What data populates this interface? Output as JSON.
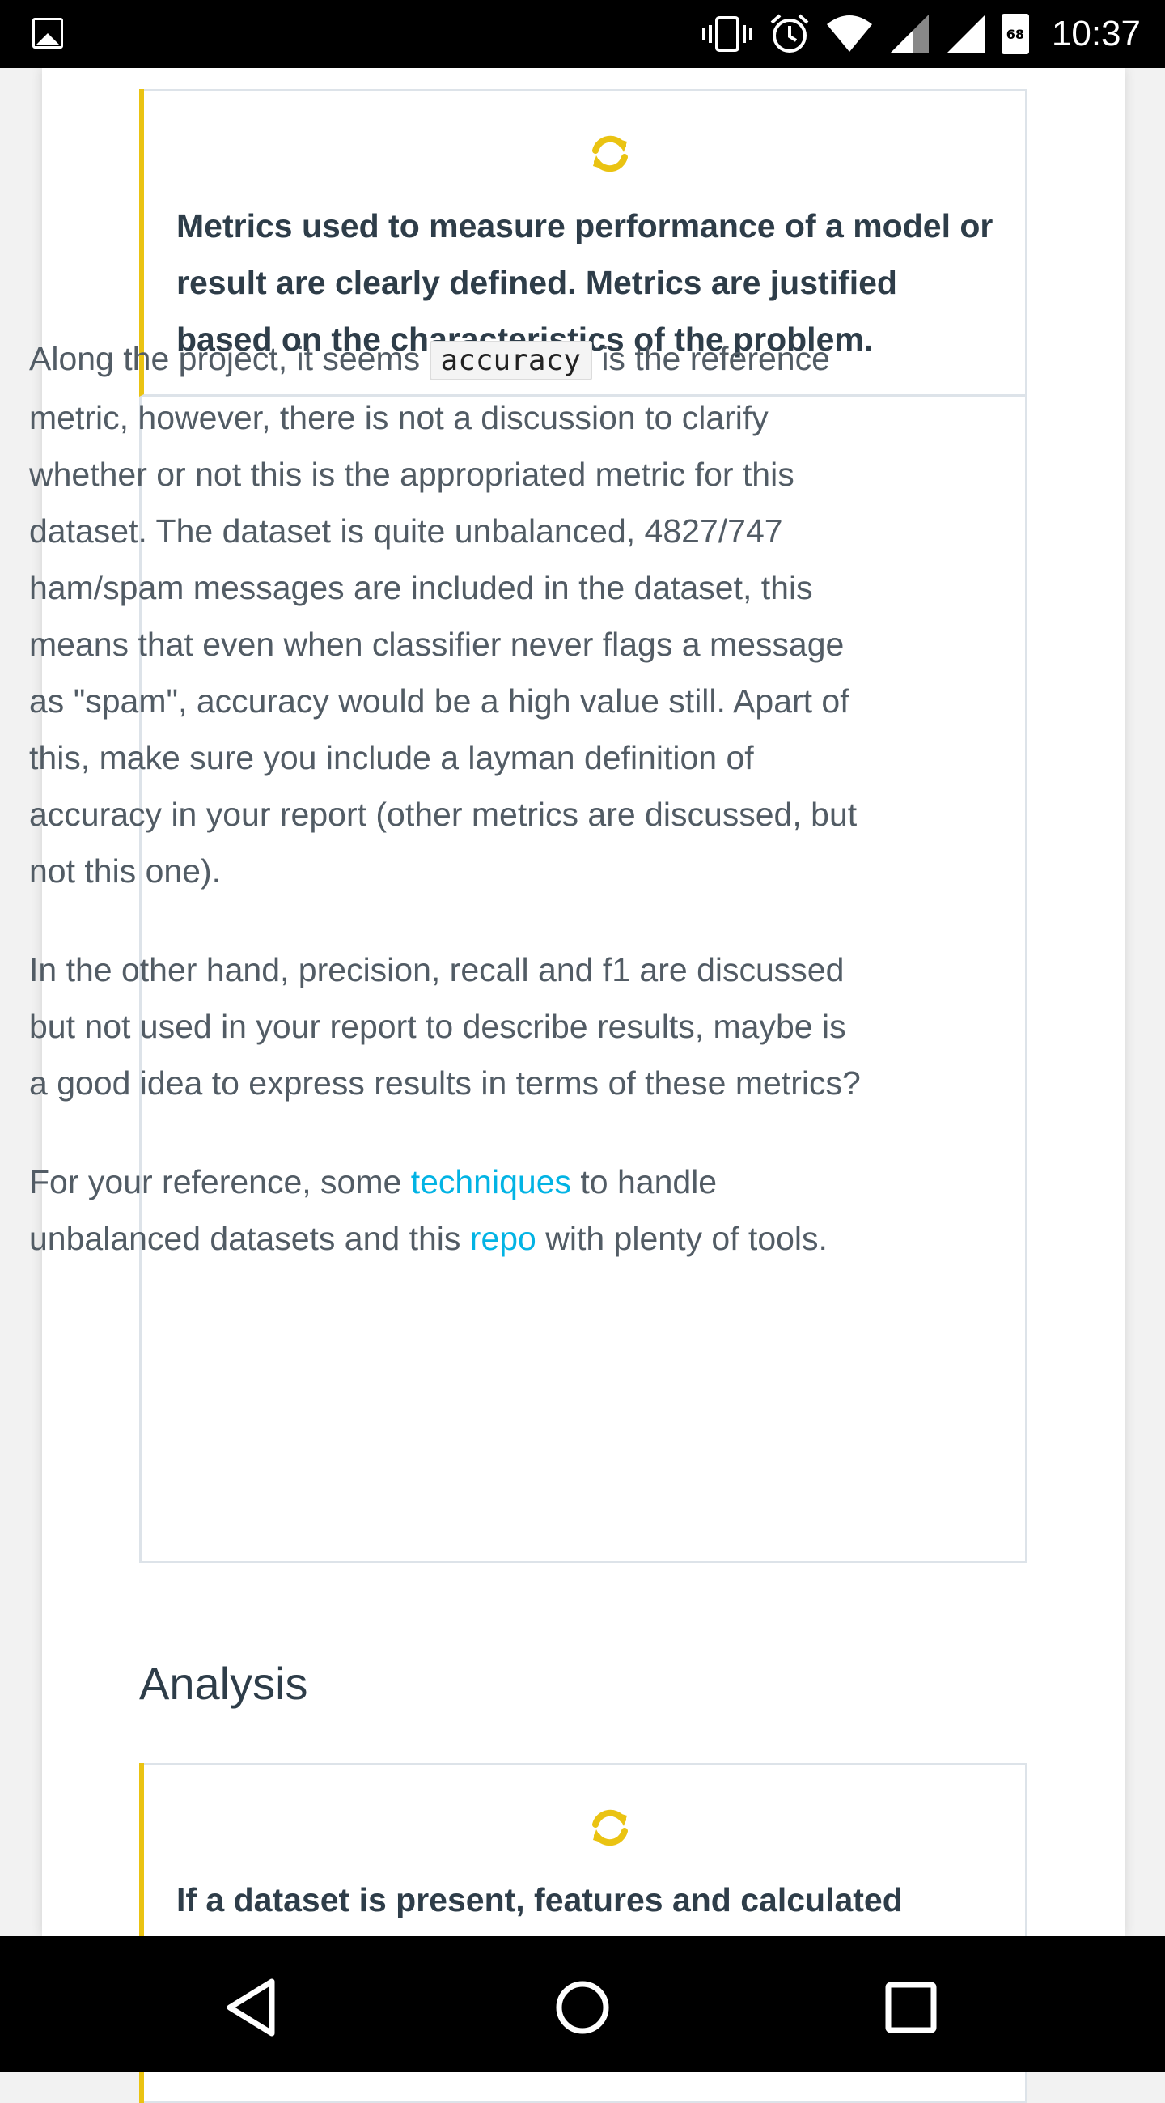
{
  "status_bar": {
    "time": "10:37",
    "battery": "68",
    "icons": [
      "gallery-icon",
      "vibrate-icon",
      "alarm-icon",
      "wifi-icon",
      "signal-icon",
      "signal-icon",
      "battery-icon"
    ]
  },
  "rubrics": [
    {
      "icon": "refresh-icon",
      "icon_color": "#eac312",
      "spec": "Metrics used to measure performance of a model or result are clearly defined. Metrics are justified based on the characteristics of the problem.",
      "review": {
        "p1_before_code": "Along the project, it seems ",
        "p1_code": "accuracy",
        "p1_after_code": " is the reference metric, however, there is not a discussion to clarify whether or not this is the appropriated metric for this dataset. The dataset is quite unbalanced, 4827/747 ham/spam messages are included in the dataset, this means that even when classifier never flags a message as \"spam\", accuracy would be a high value still. Apart of this, make sure you include a layman definition of accuracy in your report (other metrics are discussed, but not this one).",
        "p2": "In the other hand, precision, recall and f1 are discussed but not used in your report to describe results, maybe is a good idea to express results in terms of these metrics?",
        "p3_before_link1": "For your reference, some ",
        "p3_link1": "techniques",
        "p3_between": " to handle unbalanced datasets and this ",
        "p3_link2": "repo",
        "p3_after": " with plenty of tools."
      }
    },
    {
      "icon": "refresh-icon",
      "icon_color": "#eac312",
      "spec": "If a dataset is present, features and calculated"
    }
  ],
  "section_title": "Analysis",
  "nav_bar": {
    "buttons": [
      "back-button",
      "home-button",
      "recent-apps-button"
    ]
  },
  "colors": {
    "accent_yellow": "#eac312",
    "link": "#02b3e4",
    "heading": "#2e3d49",
    "body_text": "#525c65",
    "border": "#dde3e9"
  }
}
